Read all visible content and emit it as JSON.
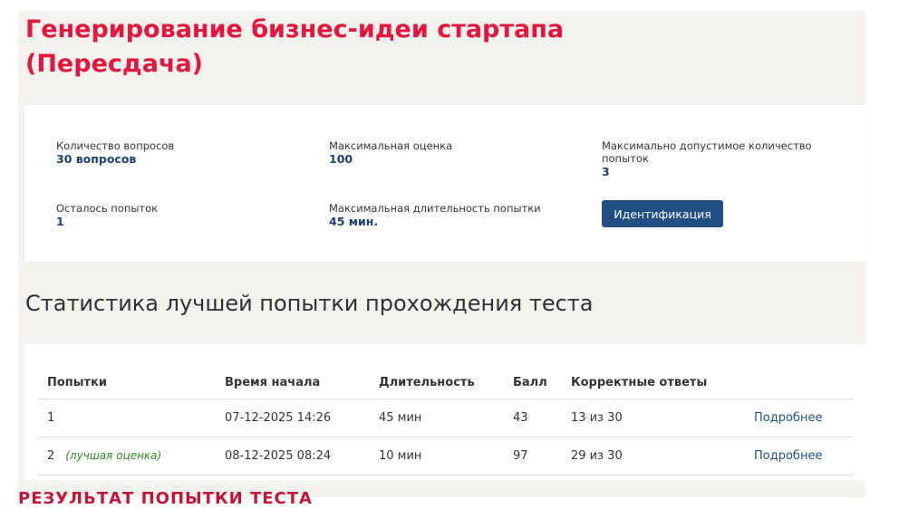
{
  "page": {
    "title_line1": "Генерирование бизнес-идеи стартапа",
    "title_line2": "(Пересдача)"
  },
  "info": {
    "questions_label": "Количество вопросов",
    "questions_value": "30 вопросов",
    "max_score_label": "Максимальная оценка",
    "max_score_value": "100",
    "max_attempts_label": "Максимально допустимое количество попыток",
    "max_attempts_value": "3",
    "remaining_label": "Осталось попыток",
    "remaining_value": "1",
    "duration_label": "Максимальная длительность попытки",
    "duration_value": "45 мин.",
    "ident_button": "Идентификация"
  },
  "stats": {
    "heading": "Статистика лучшей попытки прохождения теста",
    "columns": [
      "Попытки",
      "Время начала",
      "Длительность",
      "Балл",
      "Корректные ответы",
      ""
    ],
    "rows": [
      {
        "attempt": "1",
        "note": "",
        "start": "07-12-2025 14:26",
        "duration": "45 мин",
        "score": "43",
        "correct": "13 из 30",
        "link": "Подробнее"
      },
      {
        "attempt": "2",
        "note": "(лучшая оценка)",
        "start": "08-12-2025 08:24",
        "duration": "10 мин",
        "score": "97",
        "correct": "29 из 30",
        "link": "Подробнее"
      }
    ]
  },
  "result": {
    "heading": "РЕЗУЛЬТАТ ПОПЫТКИ ТЕСТА"
  }
}
